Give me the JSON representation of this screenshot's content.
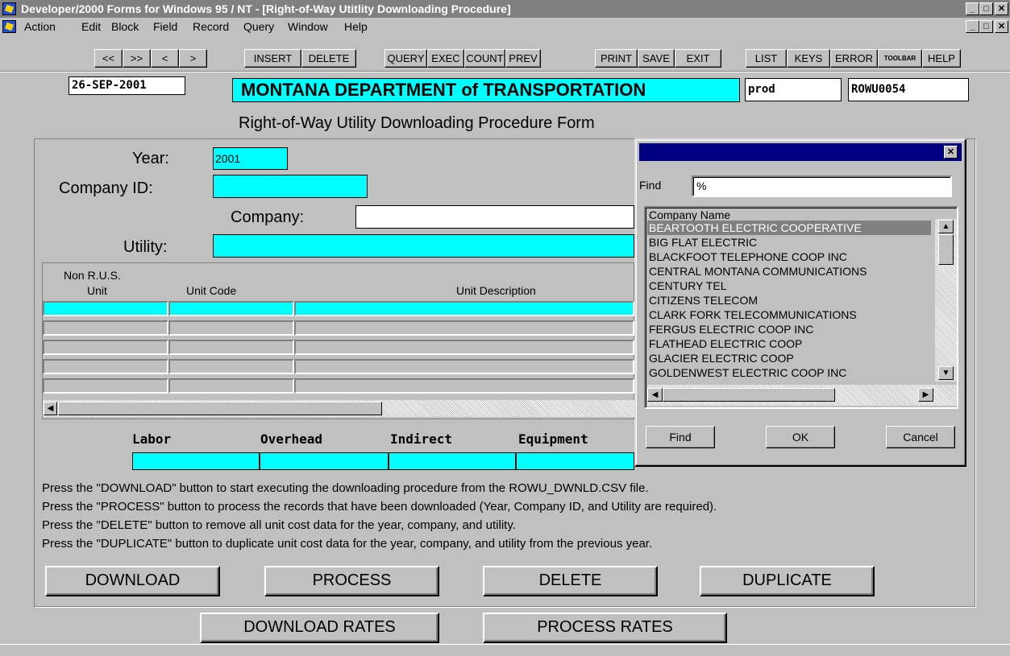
{
  "window": {
    "title": "Developer/2000 Forms for Windows 95 / NT  - [Right-of-Way Utitlity Downloading Procedure]",
    "min": "_",
    "max": "□",
    "close": "✕"
  },
  "menu": [
    "Action",
    "Edit",
    "Block",
    "Field",
    "Record",
    "Query",
    "Window",
    "Help"
  ],
  "toolbar": [
    "<<",
    ">>",
    "<",
    ">",
    "INSERT",
    "DELETE",
    "QUERY",
    "EXEC",
    "COUNT",
    "PREV",
    "PRINT",
    "SAVE",
    "EXIT",
    "LIST",
    "KEYS",
    "ERROR",
    "TOOLBAR",
    "HELP"
  ],
  "header": {
    "date": "26-SEP-2001",
    "department": "MONTANA DEPARTMENT of TRANSPORTATION",
    "environment": "prod",
    "form_code": "ROWU0054",
    "form_title": "Right-of-Way Utility Downloading Procedure Form"
  },
  "form": {
    "year_label": "Year:",
    "year_value": "2001",
    "company_id_label": "Company ID:",
    "company_id_value": "",
    "company_label": "Company:",
    "company_value": "",
    "utility_label": "Utility:",
    "utility_value": ""
  },
  "grid": {
    "col_non_rus": "Non R.U.S.",
    "col_unit": "Unit",
    "col_unit_code": "Unit Code",
    "col_unit_desc": "Unit Description",
    "rows": 5
  },
  "costs": {
    "labor": "Labor",
    "overhead": "Overhead",
    "indirect": "Indirect",
    "equipment": "Equipment"
  },
  "instructions": [
    "Press the \"DOWNLOAD\" button to start executing the downloading procedure from the ROWU_DWNLD.CSV file.",
    "Press the \"PROCESS\" button to process the records that have been downloaded (Year, Company ID, and Utility are required).",
    "Press the \"DELETE\" button to remove all unit cost data for the year, company, and utility.",
    "Press the \"DUPLICATE\" button to duplicate unit cost data for the year, company, and utility from the previous year."
  ],
  "buttons": {
    "download": "DOWNLOAD",
    "process": "PROCESS",
    "delete": "DELETE",
    "duplicate": "DUPLICATE",
    "download_rates": "DOWNLOAD RATES",
    "process_rates": "PROCESS RATES"
  },
  "lov": {
    "find_label": "Find",
    "find_value": "%",
    "column_header": "Company Name",
    "items": [
      "BEARTOOTH ELECTRIC COOPERATIVE",
      "BIG FLAT ELECTRIC",
      "BLACKFOOT TELEPHONE COOP INC",
      "CENTRAL MONTANA COMMUNICATIONS",
      "CENTURY TEL",
      "CITIZENS TELECOM",
      "CLARK FORK TELECOMMUNICATIONS",
      "FERGUS ELECTRIC COOP INC",
      "FLATHEAD ELECTRIC COOP",
      "GLACIER ELECTRIC COOP",
      "GOLDENWEST ELECTRIC COOP INC"
    ],
    "selected_index": 0,
    "find_button": "Find",
    "ok_button": "OK",
    "cancel_button": "Cancel",
    "close": "✕"
  },
  "colors": {
    "field_cyan": "#00ffff",
    "dialog_title": "#000080",
    "selection": "#808080"
  }
}
